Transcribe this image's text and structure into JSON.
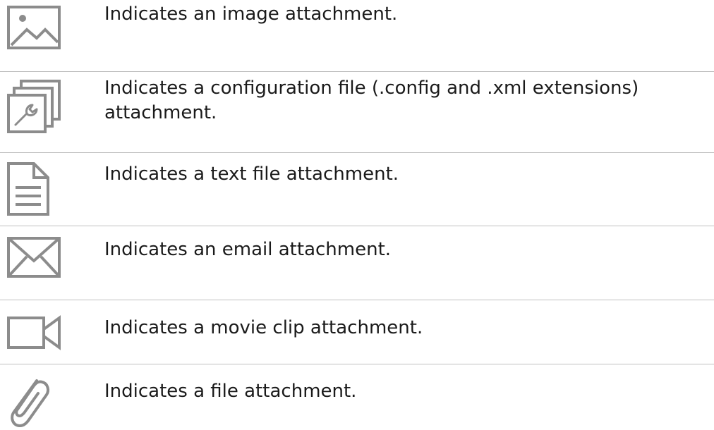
{
  "rows": [
    {
      "icon": "image-icon",
      "description": "Indicates an image attachment."
    },
    {
      "icon": "configuration-file-icon",
      "description": "Indicates a configuration file (.config and .xml extensions) attachment."
    },
    {
      "icon": "text-file-icon",
      "description": "Indicates a text file attachment."
    },
    {
      "icon": "email-icon",
      "description": "Indicates an email attachment."
    },
    {
      "icon": "movie-clip-icon",
      "description": "Indicates a movie clip attachment."
    },
    {
      "icon": "paperclip-icon",
      "description": "Indicates a file attachment."
    }
  ],
  "colors": {
    "icon_gray": "#8c8c8c",
    "divider": "#bfbfbf",
    "text": "#1a1a1a"
  }
}
